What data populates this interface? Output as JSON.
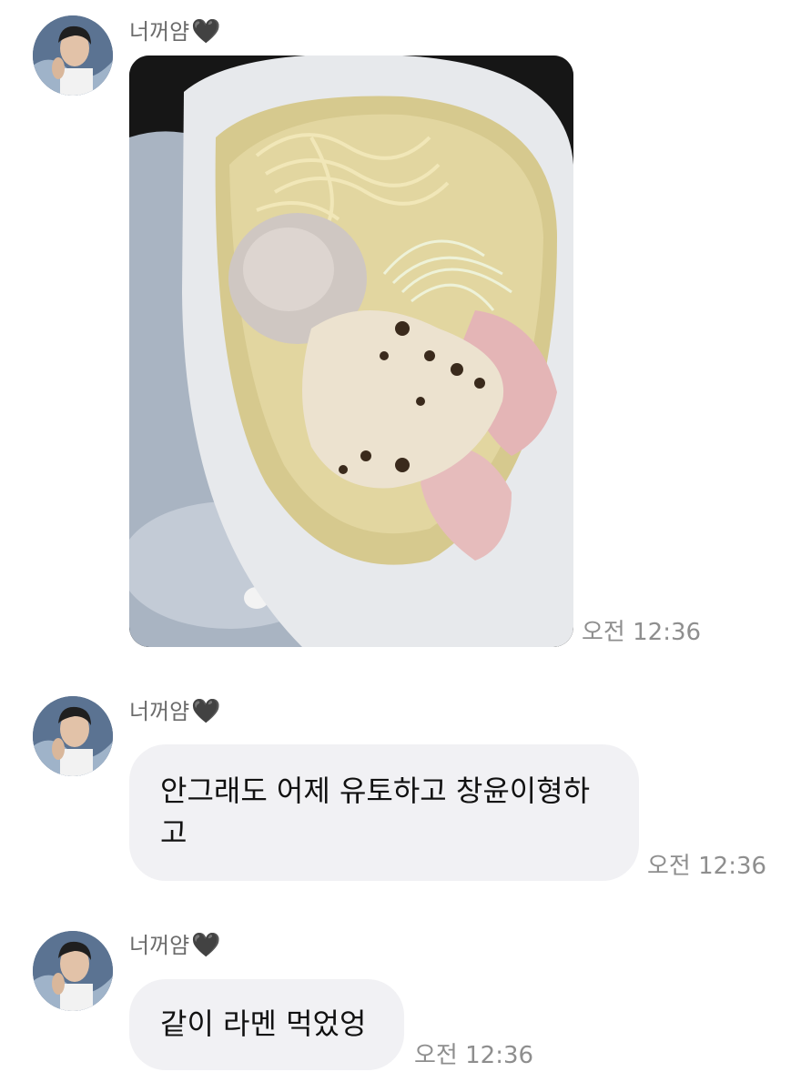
{
  "messages": [
    {
      "sender": "너꺼얌",
      "sender_heart": "🖤",
      "type": "image",
      "image_description_icon": "ramen-photo",
      "time": "오전 12:36"
    },
    {
      "sender": "너꺼얌",
      "sender_heart": "🖤",
      "type": "text",
      "text": "안그래도 어제 유토하고 창윤이형하\n고",
      "time": "오전 12:36"
    },
    {
      "sender": "너꺼얌",
      "sender_heart": "🖤",
      "type": "text",
      "text": "같이 라멘 먹었엉",
      "time": "오전 12:36"
    }
  ],
  "colors": {
    "bubble": "#f1f1f4",
    "sender_text": "#6b6b6b",
    "time_text": "#8e8e8e",
    "message_text": "#111111"
  }
}
